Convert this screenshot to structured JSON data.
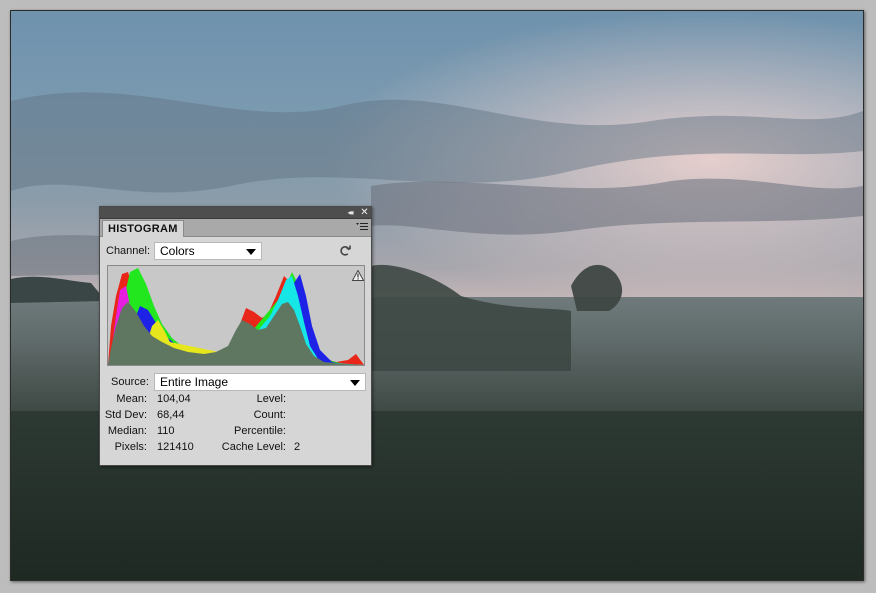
{
  "panel": {
    "tab_label": "HISTOGRAM",
    "channel_label": "Channel:",
    "channel_value": "Colors",
    "source_label": "Source:",
    "source_value": "Entire Image",
    "icons": {
      "collapse": "double-chevron-left-icon",
      "close": "close-icon",
      "panel_menu": "panel-menu-icon",
      "refresh": "refresh-icon",
      "warning": "warning-triangle-icon"
    }
  },
  "stats": {
    "mean_label": "Mean:",
    "mean": "104,04",
    "stddev_label": "Std Dev:",
    "stddev": "68,44",
    "median_label": "Median:",
    "median": "110",
    "pixels_label": "Pixels:",
    "pixels": "121410",
    "level_label": "Level:",
    "level": "",
    "count_label": "Count:",
    "count": "",
    "percentile_label": "Percentile:",
    "percentile": "",
    "cache_label": "Cache Level:",
    "cache": "2"
  },
  "histogram_colors": {
    "luminosity": "#5f7660",
    "red": "#e8261a",
    "green": "#22e61e",
    "blue": "#1e22e6",
    "cyan": "#16e6e6",
    "magenta": "#e61ee0",
    "yellow": "#e6e61c"
  }
}
